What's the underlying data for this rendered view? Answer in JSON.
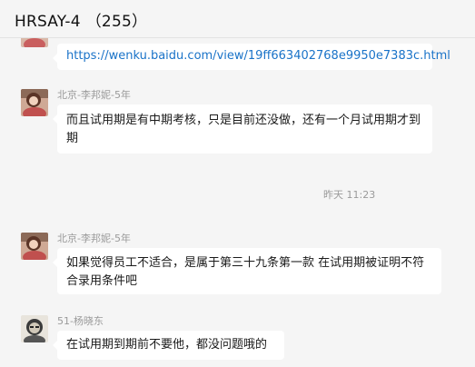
{
  "header": {
    "title": "HRSAY-4",
    "count": "（255）"
  },
  "messages": [
    {
      "sender": "",
      "text": "https://wenku.baidu.com/view/19ff663402768e9950e7383c.html"
    },
    {
      "sender": "北京-李邦妮-5年",
      "text": "而且试用期是有中期考核，只是目前还没做，还有一个月试用期才到期"
    },
    {
      "sender": "北京-李邦妮-5年",
      "text": "如果觉得员工不适合，是属于第三十九条第一款 在试用期被证明不符合录用条件吧"
    },
    {
      "sender": "51-杨晓东",
      "text": "在试用期到期前不要他，都没问题哦的"
    }
  ],
  "timestamp": "昨天 11:23"
}
